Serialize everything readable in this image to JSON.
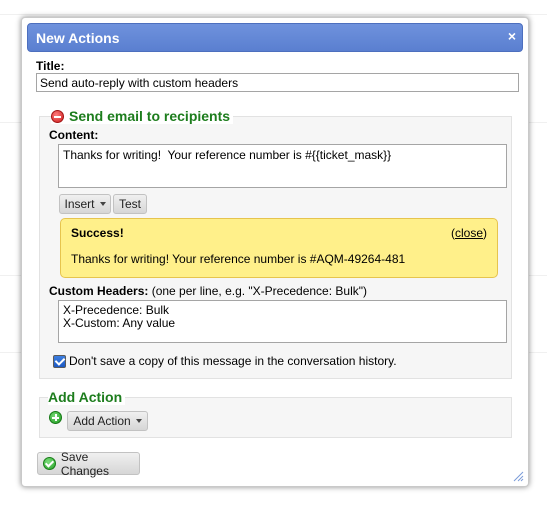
{
  "dialog": {
    "title": "New Actions",
    "close_glyph": "×"
  },
  "title_field": {
    "label": "Title:",
    "value": "Send auto-reply with custom headers"
  },
  "email_section": {
    "legend": "Send email to recipients",
    "icon": "remove-circle-icon",
    "content_label": "Content:",
    "content_value": "Thanks for writing!  Your reference number is #{{ticket_mask}}",
    "insert_label": "Insert",
    "test_label": "Test",
    "success": {
      "title": "Success!",
      "close_open": "(",
      "close_link": "close",
      "close_end": ")",
      "message": "Thanks for writing! Your reference number is #AQM-49264-481"
    },
    "headers_label": "Custom Headers:",
    "headers_hint": " (one per line, e.g. \"X-Precedence: Bulk\")",
    "headers_value": "X-Precedence: Bulk\nX-Custom: Any value",
    "no_copy_label": "Don't save a copy of this message in the conversation history.",
    "no_copy_checked": true
  },
  "add_action": {
    "legend": "Add Action",
    "button_label": "Add Action",
    "icon": "add-circle-icon"
  },
  "footer": {
    "save_label": "Save Changes",
    "icon": "check-circle-icon"
  },
  "colors": {
    "titlebar": "#5a7fd0",
    "section_legend": "#1d7d1d",
    "success_bg": "#fff08a"
  }
}
